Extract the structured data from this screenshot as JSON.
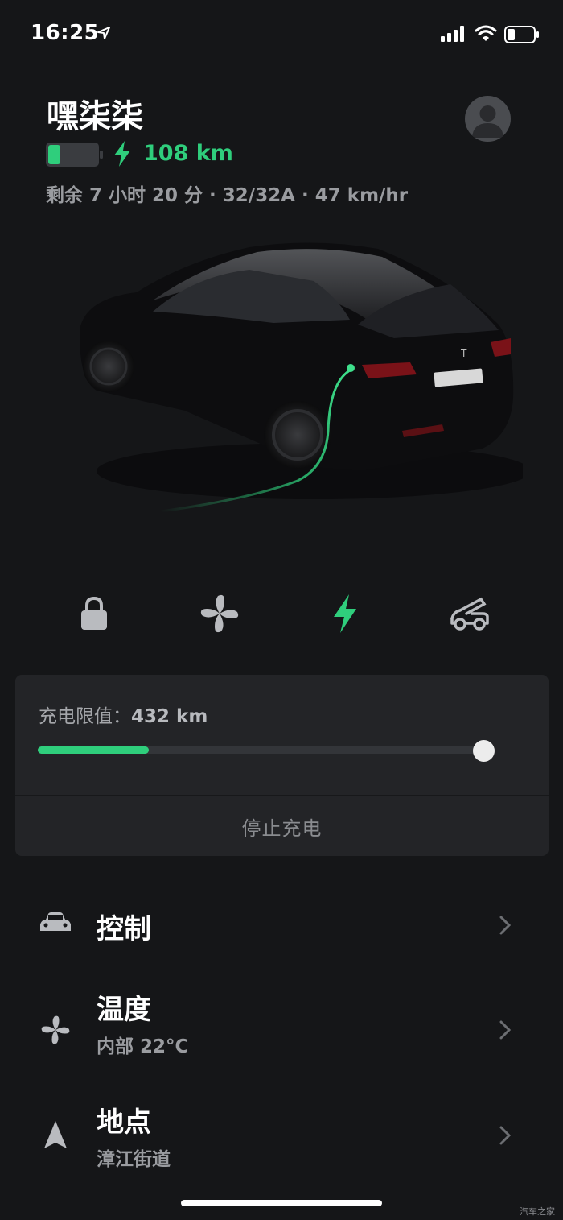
{
  "status_bar": {
    "time": "16:25",
    "icons": [
      "location-arrow-icon",
      "signal-icon",
      "wifi-icon",
      "battery-icon"
    ]
  },
  "header": {
    "car_name": "嘿柒柒",
    "range": "108 km",
    "charge_info": "剩余 7 小时 20 分 · 32/32A · 47 km/hr",
    "battery_level": 0.25
  },
  "quick_actions": [
    "lock-icon",
    "fan-icon",
    "charge-bolt-icon",
    "frunk-icon"
  ],
  "charge_panel": {
    "limit_label": "充电限值：",
    "limit_value": "432 km",
    "charge_level_fraction": 0.25,
    "limit_fraction": 1.0,
    "stop_button": "停止充电"
  },
  "menu": [
    {
      "title": "控制",
      "subtitle": "",
      "icon": "car-icon"
    },
    {
      "title": "温度",
      "subtitle": "内部 22°C",
      "icon": "fan-icon"
    },
    {
      "title": "地点",
      "subtitle": "漳江街道",
      "icon": "navigation-arrow-icon"
    }
  ],
  "watermark": "汽车之家",
  "colors": {
    "accent": "#2fce7c",
    "background": "#151618",
    "card": "#232427"
  }
}
